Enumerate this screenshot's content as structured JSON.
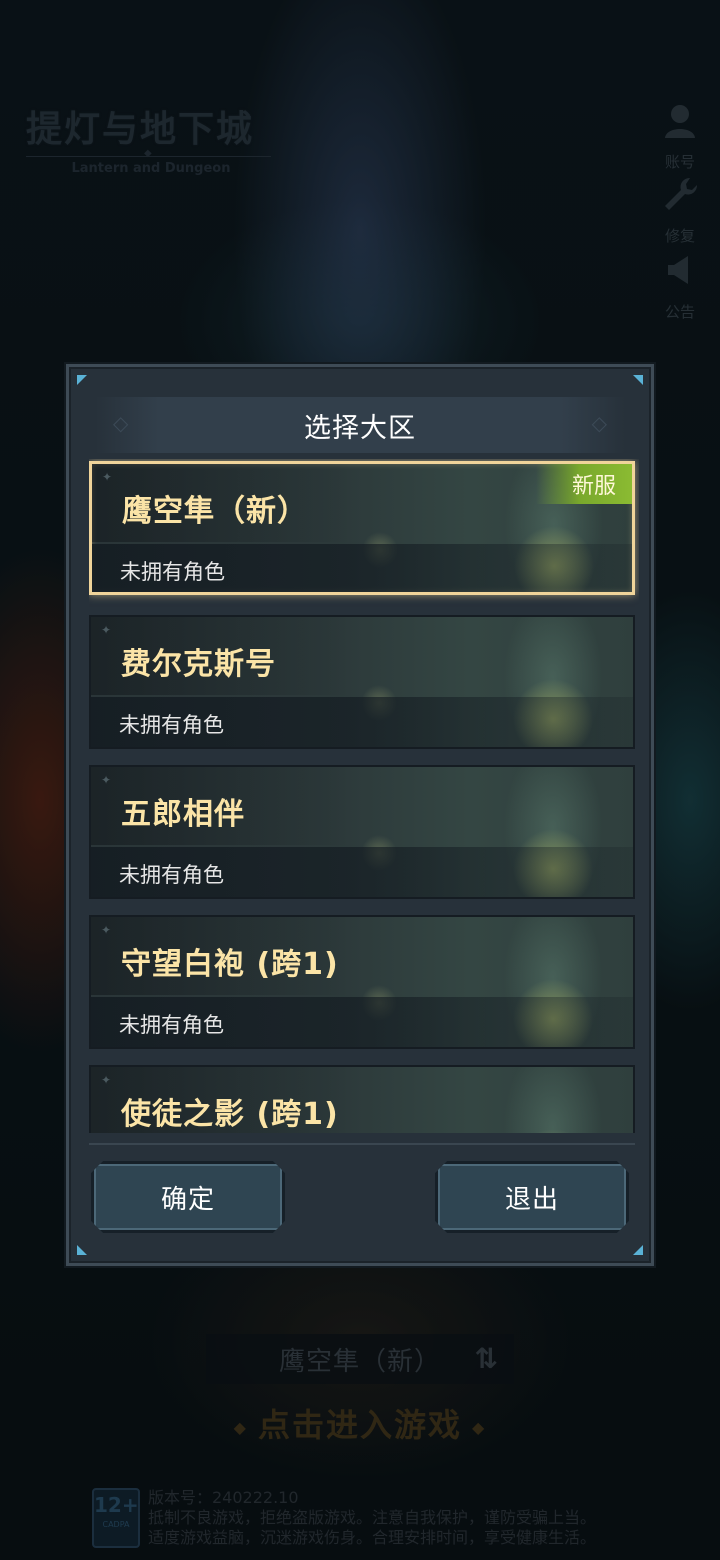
{
  "logo": {
    "title": "提灯与地下城",
    "subtitle": "Lantern and Dungeon"
  },
  "side_menu": [
    {
      "icon": "account-icon",
      "label": "账号"
    },
    {
      "icon": "wrench-icon",
      "label": "修复"
    },
    {
      "icon": "megaphone-icon",
      "label": "公告"
    }
  ],
  "dialog": {
    "title": "选择大区",
    "servers": [
      {
        "name": "鹰空隼（新）",
        "status": "未拥有角色",
        "tag": "新服",
        "selected": true
      },
      {
        "name": "费尔克斯号",
        "status": "未拥有角色",
        "tag": "",
        "selected": false
      },
      {
        "name": "五郎相伴",
        "status": "未拥有角色",
        "tag": "",
        "selected": false
      },
      {
        "name": "守望白袍 (跨1)",
        "status": "未拥有角色",
        "tag": "",
        "selected": false
      },
      {
        "name": "使徒之影 (跨1)",
        "status": "",
        "tag": "",
        "selected": false
      }
    ],
    "confirm_label": "确定",
    "exit_label": "退出"
  },
  "bottom": {
    "current_server": "鹰空隼（新）",
    "enter_label": "点击进入游戏",
    "age_rating": "12+",
    "age_caption": "CADPA",
    "version": "版本号：240222.10",
    "notice_line1": "抵制不良游戏，拒绝盗版游戏。注意自我保护，谨防受骗上当。",
    "notice_line2": "适度游戏益脑，沉迷游戏伤身。合理安排时间，享受健康生活。"
  }
}
